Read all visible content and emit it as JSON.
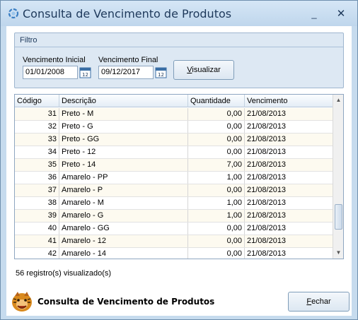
{
  "window": {
    "title": "Consulta de Vencimento de Produtos",
    "minimize_glyph": "_",
    "close_glyph": "✕",
    "icon": "refresh-gear-icon"
  },
  "filter": {
    "title": "Filtro",
    "start_label": "Vencimento Inicial",
    "start_value": "01/01/2008",
    "end_label": "Vencimento Final",
    "end_value": "09/12/2017",
    "calendar_icon": "calendar-icon",
    "view_button_mnemonic": "V",
    "view_button_rest": "isualizar"
  },
  "grid": {
    "columns": [
      "Código",
      "Descrição",
      "Quantidade",
      "Vencimento"
    ],
    "rows": [
      {
        "code": "31",
        "desc": "Preto  - M",
        "qty": "0,00",
        "venc": "21/08/2013"
      },
      {
        "code": "32",
        "desc": "Preto  - G",
        "qty": "0,00",
        "venc": "21/08/2013"
      },
      {
        "code": "33",
        "desc": "Preto  - GG",
        "qty": "0,00",
        "venc": "21/08/2013"
      },
      {
        "code": "34",
        "desc": "Preto  - 12",
        "qty": "0,00",
        "venc": "21/08/2013"
      },
      {
        "code": "35",
        "desc": "Preto  - 14",
        "qty": "7,00",
        "venc": "21/08/2013"
      },
      {
        "code": "36",
        "desc": "Amarelo  - PP",
        "qty": "1,00",
        "venc": "21/08/2013"
      },
      {
        "code": "37",
        "desc": "Amarelo  - P",
        "qty": "0,00",
        "venc": "21/08/2013"
      },
      {
        "code": "38",
        "desc": "Amarelo  - M",
        "qty": "1,00",
        "venc": "21/08/2013"
      },
      {
        "code": "39",
        "desc": "Amarelo  - G",
        "qty": "1,00",
        "venc": "21/08/2013"
      },
      {
        "code": "40",
        "desc": "Amarelo  - GG",
        "qty": "0,00",
        "venc": "21/08/2013"
      },
      {
        "code": "41",
        "desc": "Amarelo  - 12",
        "qty": "0,00",
        "venc": "21/08/2013"
      },
      {
        "code": "42",
        "desc": "Amarelo  - 14",
        "qty": "0,00",
        "venc": "21/08/2013"
      }
    ],
    "scroll_position": 0.85
  },
  "status": {
    "record_count": "56 registro(s) visualizado(s)"
  },
  "footer": {
    "title": "Consulta de Vencimento de Produtos",
    "logo_icon": "tiger-logo-icon",
    "close_mnemonic": "F",
    "close_rest": "echar"
  },
  "colors": {
    "frame": "#c6dbee",
    "panel": "#dde8f3",
    "row_alt": "#fdfaf0",
    "title_text": "#1e395b"
  }
}
